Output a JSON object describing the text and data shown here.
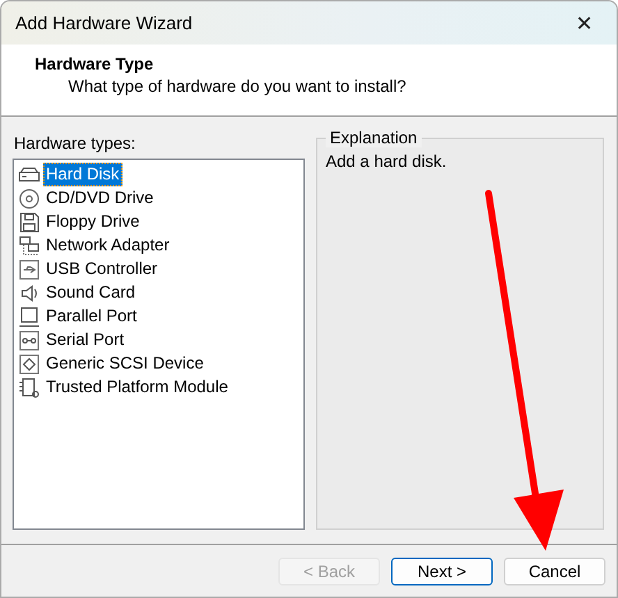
{
  "window": {
    "title": "Add Hardware Wizard",
    "close": "✕"
  },
  "header": {
    "title": "Hardware Type",
    "subtitle": "What type of hardware do you want to install?"
  },
  "hardware_types": {
    "label": "Hardware types:",
    "items": [
      {
        "label": "Hard Disk",
        "kind": "disk",
        "selected": true
      },
      {
        "label": "CD/DVD Drive",
        "kind": "cd",
        "selected": false
      },
      {
        "label": "Floppy Drive",
        "kind": "floppy",
        "selected": false
      },
      {
        "label": "Network Adapter",
        "kind": "network",
        "selected": false
      },
      {
        "label": "USB Controller",
        "kind": "usb",
        "selected": false
      },
      {
        "label": "Sound Card",
        "kind": "sound",
        "selected": false
      },
      {
        "label": "Parallel Port",
        "kind": "parallel",
        "selected": false
      },
      {
        "label": "Serial Port",
        "kind": "serial",
        "selected": false
      },
      {
        "label": "Generic SCSI Device",
        "kind": "scsi",
        "selected": false
      },
      {
        "label": "Trusted Platform Module",
        "kind": "tpm",
        "selected": false
      }
    ]
  },
  "explanation": {
    "label": "Explanation",
    "text": "Add a hard disk."
  },
  "buttons": [
    {
      "label": "< Back",
      "disabled": true,
      "kind": "normal"
    },
    {
      "label": "Next >",
      "disabled": false,
      "kind": "default"
    },
    {
      "label": "Cancel",
      "disabled": false,
      "kind": "normal"
    }
  ],
  "annotation": {
    "kind": "arrow"
  }
}
